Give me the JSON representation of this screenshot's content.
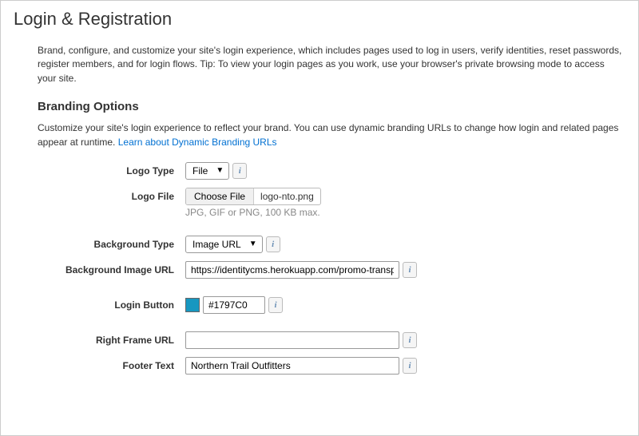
{
  "header": {
    "title": "Login & Registration",
    "description": "Brand, configure, and customize your site's login experience, which includes pages used to log in users, verify identities, reset passwords, register members, and for login flows. Tip: To view your login pages as you work, use your browser's private browsing mode to access your site."
  },
  "branding": {
    "section_title": "Branding Options",
    "section_desc_prefix": "Customize your site's login experience to reflect your brand. You can use dynamic branding URLs to change how login and related pages appear at runtime. ",
    "link_text": "Learn about Dynamic Branding URLs",
    "logo_type": {
      "label": "Logo Type",
      "value": "File"
    },
    "logo_file": {
      "label": "Logo File",
      "button": "Choose File",
      "filename": "logo-nto.png",
      "hint": "JPG, GIF or PNG, 100 KB max."
    },
    "background_type": {
      "label": "Background Type",
      "value": "Image URL"
    },
    "background_image_url": {
      "label": "Background Image URL",
      "value": "https://identitycms.herokuapp.com/promo-transp"
    },
    "login_button": {
      "label": "Login Button",
      "value": "#1797C0",
      "swatch": "#1797C0"
    },
    "right_frame_url": {
      "label": "Right Frame URL",
      "value": ""
    },
    "footer_text": {
      "label": "Footer Text",
      "value": "Northern Trail Outfitters"
    }
  }
}
